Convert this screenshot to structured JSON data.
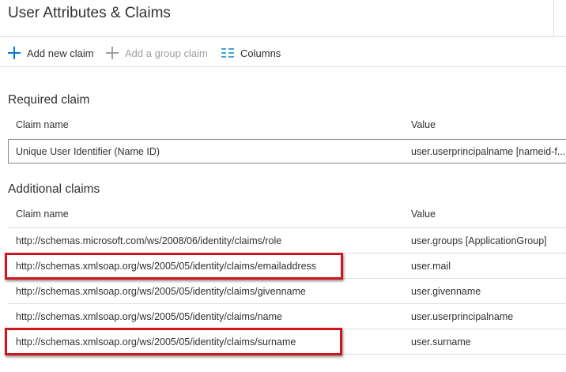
{
  "page": {
    "title": "User Attributes & Claims"
  },
  "toolbar": {
    "add_new_claim": "Add new claim",
    "add_group_claim": "Add a group claim",
    "columns": "Columns"
  },
  "required": {
    "heading": "Required claim",
    "col_name": "Claim name",
    "col_value": "Value",
    "rows": [
      {
        "name": "Unique User Identifier (Name ID)",
        "value": "user.userprincipalname [nameid-f..."
      }
    ]
  },
  "additional": {
    "heading": "Additional claims",
    "col_name": "Claim name",
    "col_value": "Value",
    "rows": [
      {
        "name": "http://schemas.microsoft.com/ws/2008/06/identity/claims/role",
        "value": "user.groups [ApplicationGroup]",
        "highlighted": false
      },
      {
        "name": "http://schemas.xmlsoap.org/ws/2005/05/identity/claims/emailaddress",
        "value": "user.mail",
        "highlighted": true
      },
      {
        "name": "http://schemas.xmlsoap.org/ws/2005/05/identity/claims/givenname",
        "value": "user.givenname",
        "highlighted": false
      },
      {
        "name": "http://schemas.xmlsoap.org/ws/2005/05/identity/claims/name",
        "value": "user.userprincipalname",
        "highlighted": false
      },
      {
        "name": "http://schemas.xmlsoap.org/ws/2005/05/identity/claims/surname",
        "value": "user.surname",
        "highlighted": true
      }
    ]
  },
  "colors": {
    "accent": "#0078d4",
    "highlight": "#d2141c",
    "disabled": "#a19f9d"
  },
  "icons": {
    "add": "plus-icon",
    "columns": "columns-icon"
  }
}
